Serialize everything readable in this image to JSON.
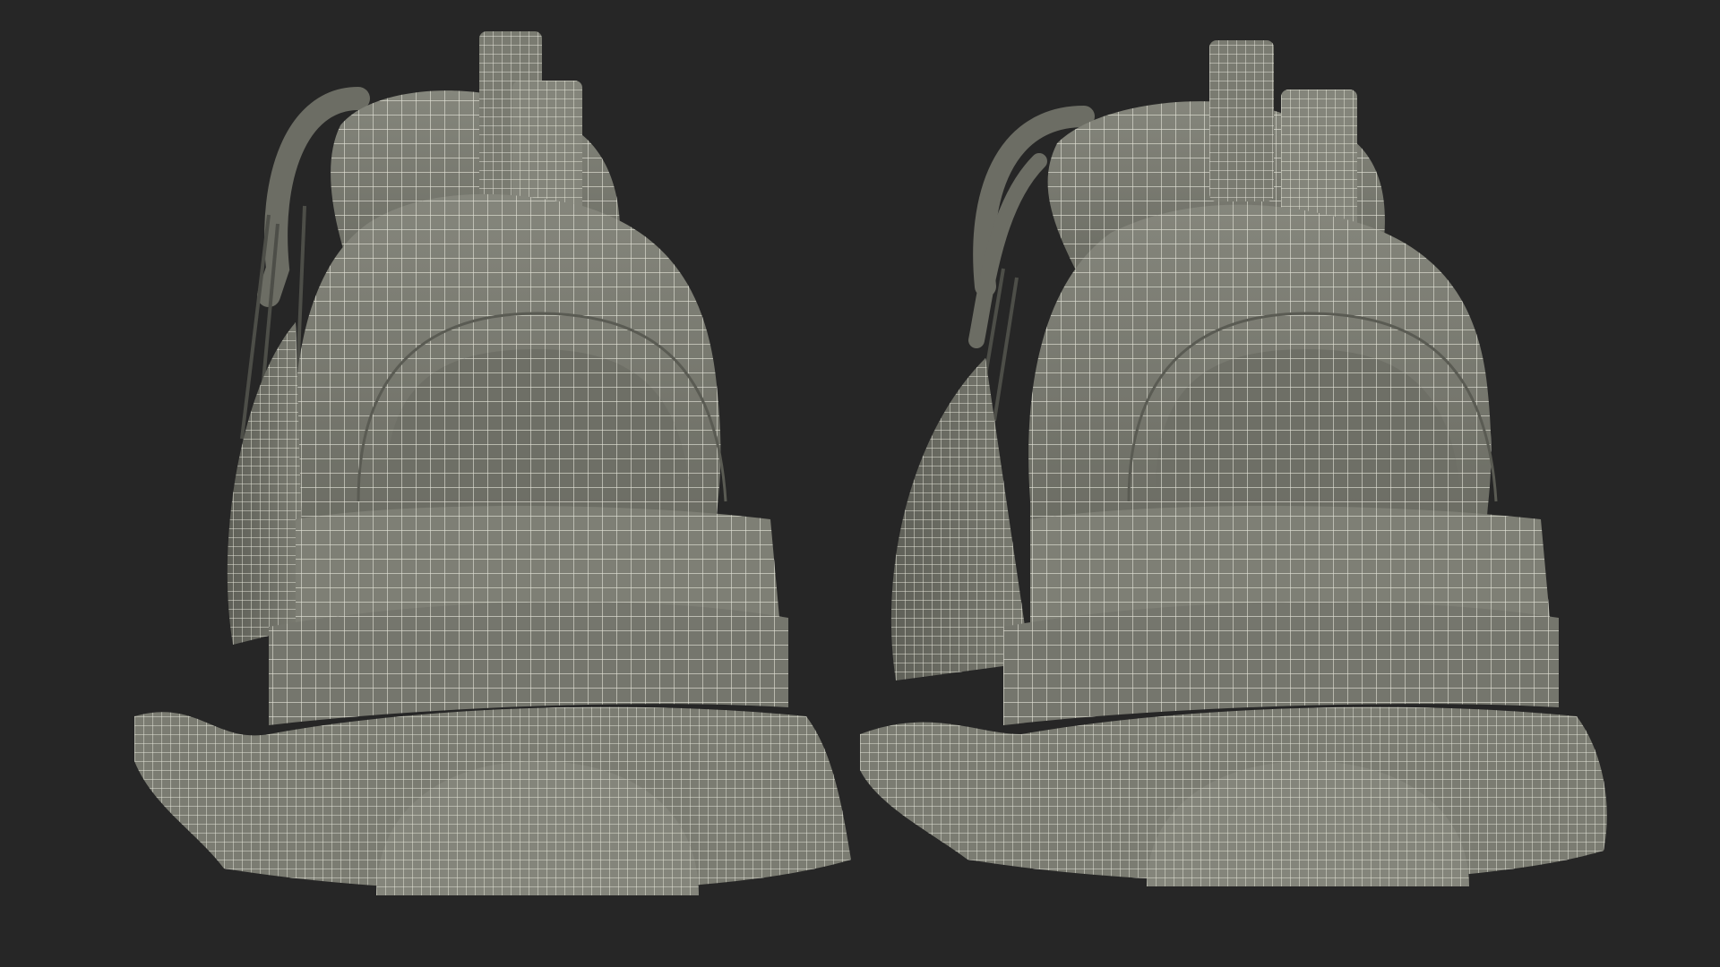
{
  "scene": {
    "description_visible_text": "",
    "colors": {
      "background": "#262626",
      "surface": "#7d7e74",
      "surface_light": "#8d8e84",
      "surface_dark": "#5e5f57",
      "wire": "#e6e6da"
    },
    "objects": [
      {
        "name": "left-sneaker",
        "view": "rear"
      },
      {
        "name": "right-sneaker",
        "view": "rear"
      }
    ]
  }
}
